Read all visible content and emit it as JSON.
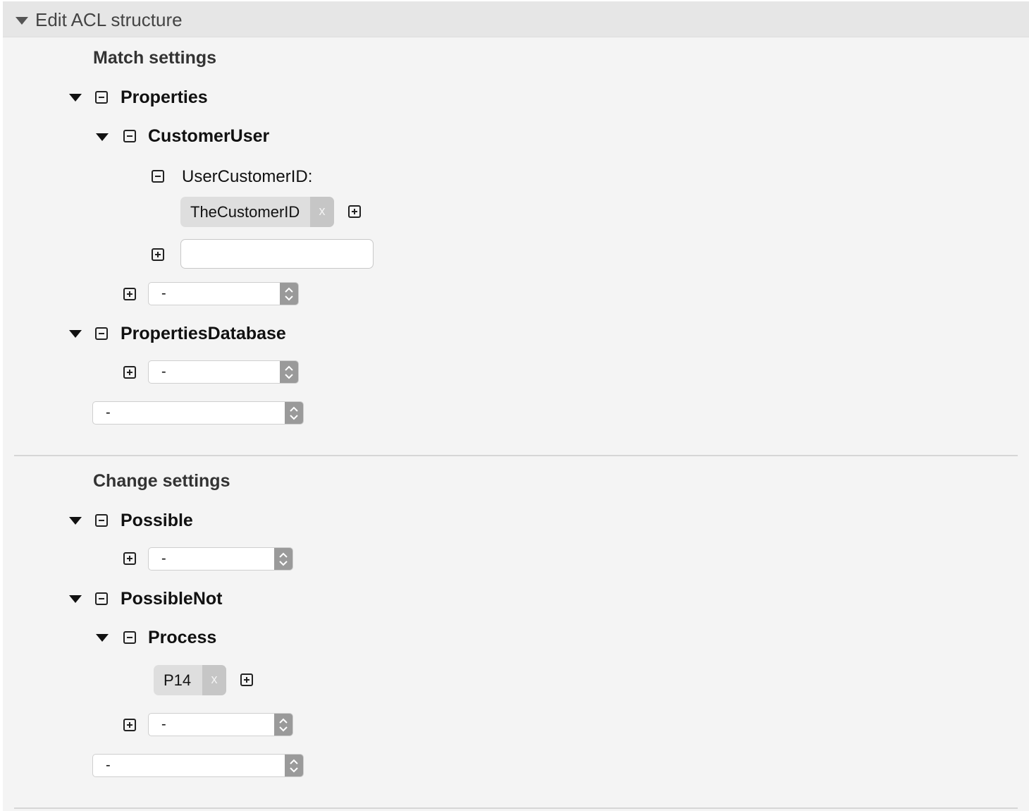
{
  "header": {
    "title": "Edit ACL structure"
  },
  "match": {
    "title": "Match settings",
    "properties": {
      "label": "Properties",
      "customer_user": {
        "label": "CustomerUser",
        "key_label": "UserCustomerID:",
        "tag": "TheCustomerID",
        "tag_remove": "x",
        "new_value": "",
        "select": "-"
      }
    },
    "properties_database": {
      "label": "PropertiesDatabase",
      "select": "-"
    },
    "select": "-"
  },
  "change": {
    "title": "Change settings",
    "possible": {
      "label": "Possible",
      "select": "-"
    },
    "possible_not": {
      "label": "PossibleNot",
      "process": {
        "label": "Process",
        "tag": "P14",
        "tag_remove": "x"
      },
      "select": "-"
    },
    "select": "-"
  }
}
